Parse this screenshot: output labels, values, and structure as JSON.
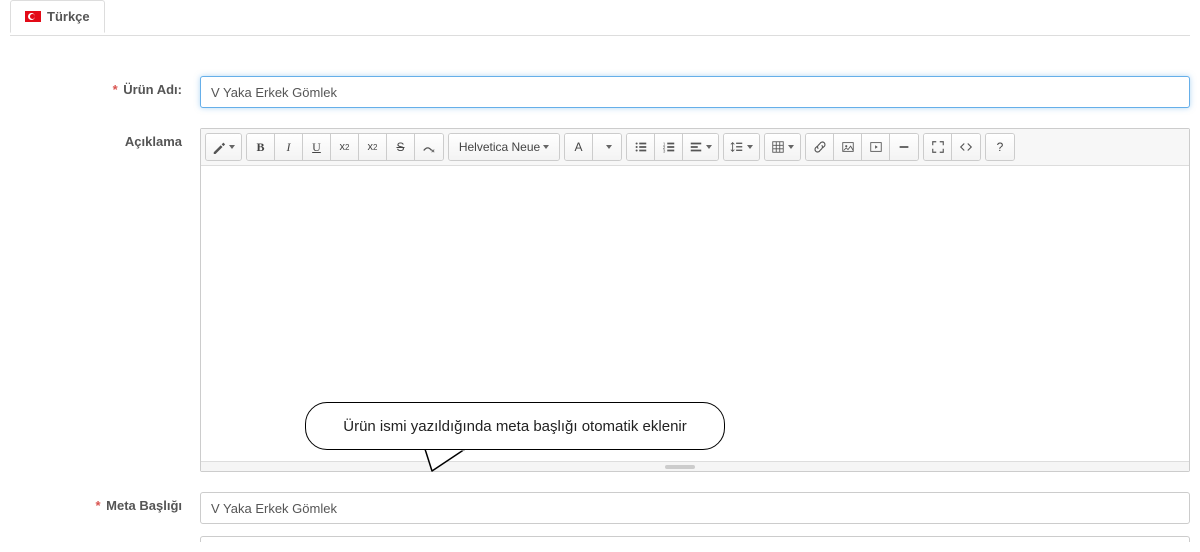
{
  "tab": {
    "label": "Türkçe"
  },
  "labels": {
    "product_name": "Ürün Adı:",
    "description": "Açıklama",
    "meta_title": "Meta Başlığı"
  },
  "fields": {
    "product_name_value": "V Yaka Erkek Gömlek",
    "meta_title_value": "V Yaka Erkek Gömlek"
  },
  "toolbar": {
    "font_family": "Helvetica Neue"
  },
  "callout": {
    "text": "Ürün ismi yazıldığında meta başlığı otomatik eklenir"
  }
}
